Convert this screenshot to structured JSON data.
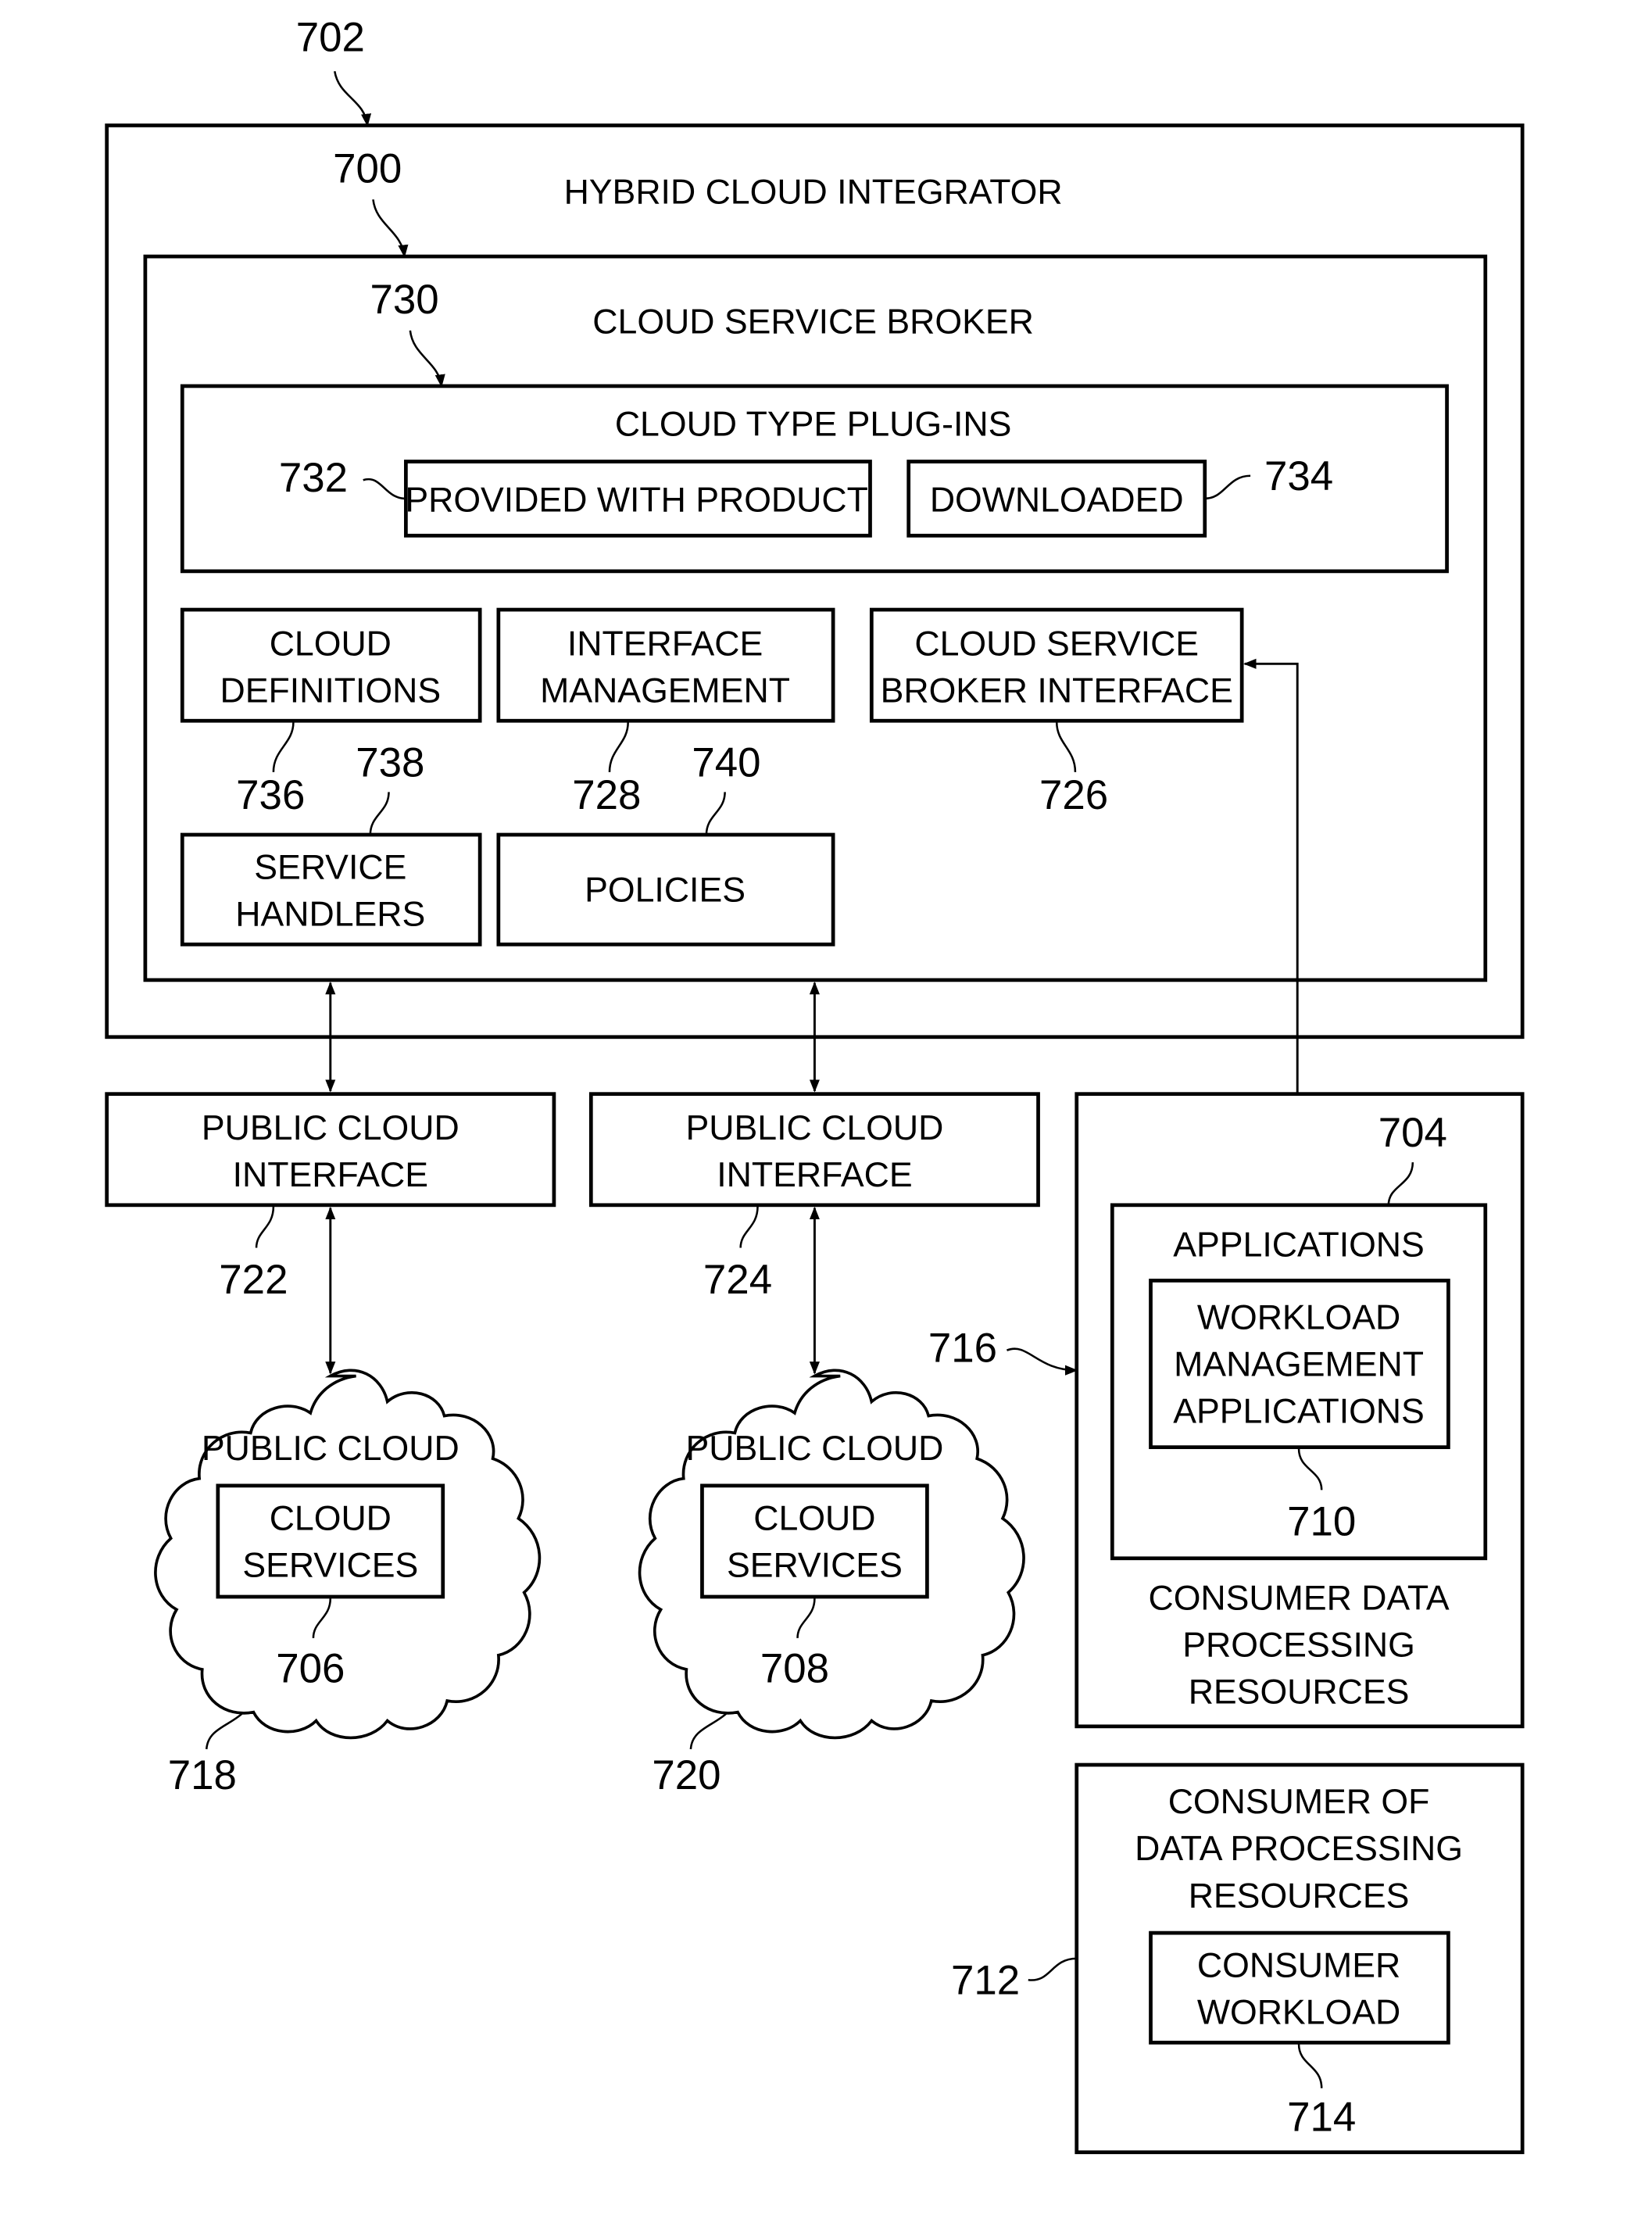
{
  "figure": {
    "hybrid_cloud_integrator": {
      "label": "HYBRID CLOUD INTEGRATOR",
      "ref": "702",
      "ref_inner": "700"
    },
    "cloud_service_broker": {
      "label": "CLOUD SERVICE BROKER",
      "ref": "730"
    },
    "cloud_type_plugins": {
      "label": "CLOUD TYPE PLUG-INS",
      "provided": {
        "label": "PROVIDED WITH PRODUCT",
        "ref": "732"
      },
      "downloaded": {
        "label": "DOWNLOADED",
        "ref": "734"
      }
    },
    "cloud_definitions": {
      "lines": [
        "CLOUD",
        "DEFINITIONS"
      ],
      "ref": "736"
    },
    "interface_management": {
      "lines": [
        "INTERFACE",
        "MANAGEMENT"
      ],
      "ref": "728"
    },
    "cloud_service_broker_interface": {
      "lines": [
        "CLOUD SERVICE",
        "BROKER INTERFACE"
      ],
      "ref": "726"
    },
    "service_handlers": {
      "lines": [
        "SERVICE",
        "HANDLERS"
      ],
      "ref": "738"
    },
    "policies": {
      "label": "POLICIES",
      "ref": "740"
    },
    "public_cloud_interface_1": {
      "lines": [
        "PUBLIC CLOUD",
        "INTERFACE"
      ],
      "ref": "722"
    },
    "public_cloud_interface_2": {
      "lines": [
        "PUBLIC CLOUD",
        "INTERFACE"
      ],
      "ref": "724"
    },
    "public_cloud_1": {
      "label": "PUBLIC CLOUD",
      "services": [
        "CLOUD",
        "SERVICES"
      ],
      "services_ref": "706",
      "ref": "718"
    },
    "public_cloud_2": {
      "label": "PUBLIC CLOUD",
      "services": [
        "CLOUD",
        "SERVICES"
      ],
      "services_ref": "708",
      "ref": "720"
    },
    "consumer_data_processing": {
      "ref": "716",
      "label_lines": [
        "CONSUMER DATA",
        "PROCESSING",
        "RESOURCES"
      ],
      "applications": {
        "label": "APPLICATIONS",
        "ref": "704"
      },
      "workload_mgmt": {
        "lines": [
          "WORKLOAD",
          "MANAGEMENT",
          "APPLICATIONS"
        ],
        "ref": "710"
      }
    },
    "consumer_of_resources": {
      "ref": "712",
      "label_lines": [
        "CONSUMER OF",
        "DATA PROCESSING",
        "RESOURCES"
      ],
      "workload": {
        "lines": [
          "CONSUMER",
          "WORKLOAD"
        ],
        "ref": "714"
      }
    }
  }
}
